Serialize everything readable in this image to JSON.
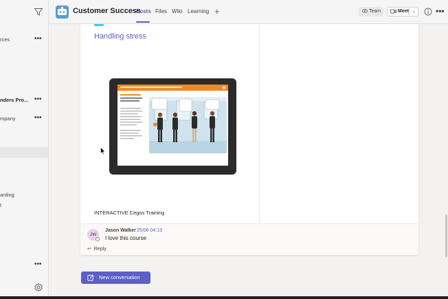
{
  "sidebar": {
    "items": [
      {
        "label": "rces",
        "bold": false,
        "more": true
      },
      {
        "label": "nders Pro...",
        "bold": true,
        "more": true
      },
      {
        "label": "mpany",
        "bold": false,
        "more": true
      },
      {
        "label": "arding",
        "bold": false,
        "more": false
      },
      {
        "label": "t",
        "bold": false,
        "more": false
      }
    ],
    "more_label": "•••"
  },
  "header": {
    "team_name": "Customer Success",
    "tabs": [
      {
        "label": "Posts",
        "active": true
      },
      {
        "label": "Files",
        "active": false
      },
      {
        "label": "Wiki",
        "active": false
      },
      {
        "label": "Learning",
        "active": false
      }
    ],
    "add_tab": "+",
    "team_button": "Team",
    "meet_button": "Meet",
    "more": "•••"
  },
  "post": {
    "title": "Handling stress",
    "caption": "INTERACTIVE   Cegos Training",
    "reply": {
      "initials": "JW",
      "author": "Jason Walker",
      "time": "25/06 04:13",
      "text": "I love this course",
      "reply_label": "Reply"
    }
  },
  "new_conversation": "New conversation",
  "colors": {
    "accent": "#5b5fc7",
    "orange_bar": "#f08a24",
    "team_logo": "#5b9bd5"
  }
}
